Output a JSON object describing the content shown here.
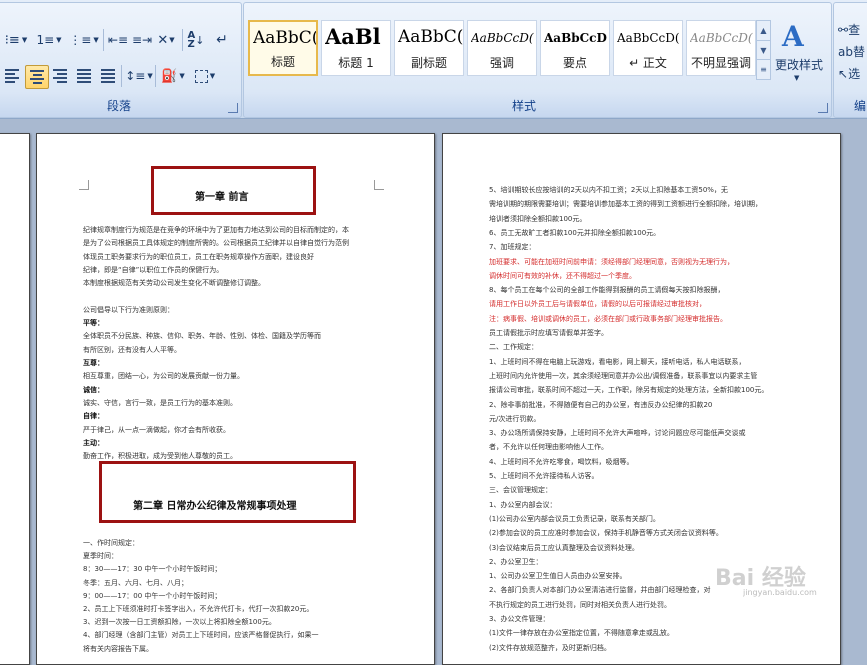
{
  "ribbon": {
    "paragraph_group": {
      "label": "段落"
    },
    "styles_group": {
      "label": "样式",
      "items": [
        {
          "preview": "AaBbC(",
          "name": "标题"
        },
        {
          "preview": "AaBl",
          "name": "标题 1"
        },
        {
          "preview": "AaBbC(",
          "name": "副标题"
        },
        {
          "preview": "AaBbCcD(",
          "name": "强调"
        },
        {
          "preview": "AaBbCcD",
          "name": "要点"
        },
        {
          "preview": "AaBbCcD(",
          "name": "↵ 正文"
        },
        {
          "preview": "AaBbCcD(",
          "name": "不明显强调"
        }
      ],
      "change_styles_label": "更改样式"
    },
    "editing_group": {
      "label": "编",
      "find_label": "查",
      "replace_label": "替",
      "select_label": "选"
    }
  },
  "left_page": {
    "chapter1_title": "第一章 前言",
    "chapter2_title": "第二章 日常办公纪律及常规事项处理",
    "lines_part1": [
      "   纪律规章制度行为规范是在竞争的环境中为了更加有力地达到公司的目标而制定的，本",
      "是为了公司根据员工具体规定的制度所需的。公司根据员工纪律并以自律自觉行为范例",
      "体现员工职务要求行为的职位员工，员工在职务规章操作方面职，建设良好",
      "纪律，即是“自律”以职位工作员的保健行为。",
      "   本制度根据规范有关劳动公司发生变化不断调整修订调整。",
      "",
      "   公司倡导以下行为准则原则：",
      "平等：",
      "   全体职员不分民族、种族、信仰、职务、年龄、性别、体检、国籍及学历等而",
      "有所区别，还有没有人人平等。",
      "互尊：",
      "   相互尊重，团结一心，为公司的发展贡献一份力量。",
      "诚信：",
      "   诚实、守信，言行一致，是员工行为的基本准则。",
      "自律：",
      "   严于律己，从一点一滴做起，你才会有所收获。",
      "主动：",
      "   勤奋工作，积极进取，成为受到他人尊敬的员工。"
    ],
    "lines_part2": [
      "一、作时间规定：",
      "   夏季时间：",
      "   8：30——17：30  中午一个小时午饭时间；",
      "   冬季：五月、六月、七月、八月；",
      "   9：00——17：00  中午一个小时午饭时间；",
      "2、员工上下班须准时打卡签字出入，不允许代打卡，代打一次扣款20元。",
      "3、迟到一次按一日工资额扣除，一次以上将扣除全额100元。",
      "4、部门经理（含部门主管）对员工上下班时间，应该严格督促执行，如果一",
      "将有关内容报告下属。"
    ]
  },
  "right_page": {
    "lines": [
      "5、培训期较长应按培训的2天以内不扣工资；2天以上扣除基本工资50%，无",
      "需培训期的期限需要培训；需要培训参加基本工资的得到工资额进行全额扣除，培训期，",
      "培训者须扣除全额扣款100元。",
      "6、员工无故旷工者扣款100元并扣除全额扣款100元。",
      "7、加班规定：",
      "   加班要求、可能在加班时间前申请：须经得部门经理同意，否则视为无理行为，",
      "调休时间可有效的补休，还不得超过一个季度。",
      "8、每个员工在每个公司的全部工作能得到报酬的员工请假每天按扣除报酬，",
      "请用工作日以外员工后与请假单位，请假的以后可报请经过审批核对，",
      "   注：病事假、培训或调休的员工，必须在部门或行政事务部门经理审批报告。",
      "   员工请假批示时应填写请假单并签字。",
      "二、工作规定：",
      "1、上班时间不得在电脑上玩游戏，看电影，网上聊天，接听电话，私人电话联系，",
      "上班时间内允许使用一次，其余须经理同意并办公出/调假准备，联系事宜以内要求主管",
      "报请公司审批，联系时间不超过一天，工作职，除另有规定的处理方法，全新扣款100元。",
      "2、除非事前批准，不得随便有自己的办公室，有违反办公纪律的扣款20",
      "元/次进行罚款。",
      "3、办公场所请保持安静，上班时间不允许大声喧哗，讨论问题应尽可能低声交谈或",
      "者，不允许以任何理由影响他人工作。",
      "4、上班时间不允许吃零食，喝饮料，吸烟等。",
      "5、上班时间不允许接待私人访客。",
      "三、会议管理规定：",
      "1、办公室内部会议：",
      "(1)公司办公室内部会议员工负责记录，联系有关部门。",
      "(2)参加会议的员工应准时参加会议，保持手机静音等方式关闭会议资料等。",
      "(3)会议结束后员工应认真整理及会议资料处理。",
      "2、办公室卫生：",
      "1、公司办公室卫生值日人员由办公室安排。",
      "2、各部门负责人对本部门办公室清洁进行监督，并由部门经理检查，对",
      "不执行规定的员工进行处罚，同时对相关负责人进行处罚。",
      "3、办公文件管理：",
      "(1)文件一律存放在办公室指定位置，不得随意拿走或乱放。",
      "(2)文件存放规范整齐，及时更新归档。"
    ],
    "red_line_indices": [
      5,
      6,
      8,
      9
    ]
  },
  "watermark_text": "Bai 经验",
  "watermark_url": "jingyan.baidu.com"
}
